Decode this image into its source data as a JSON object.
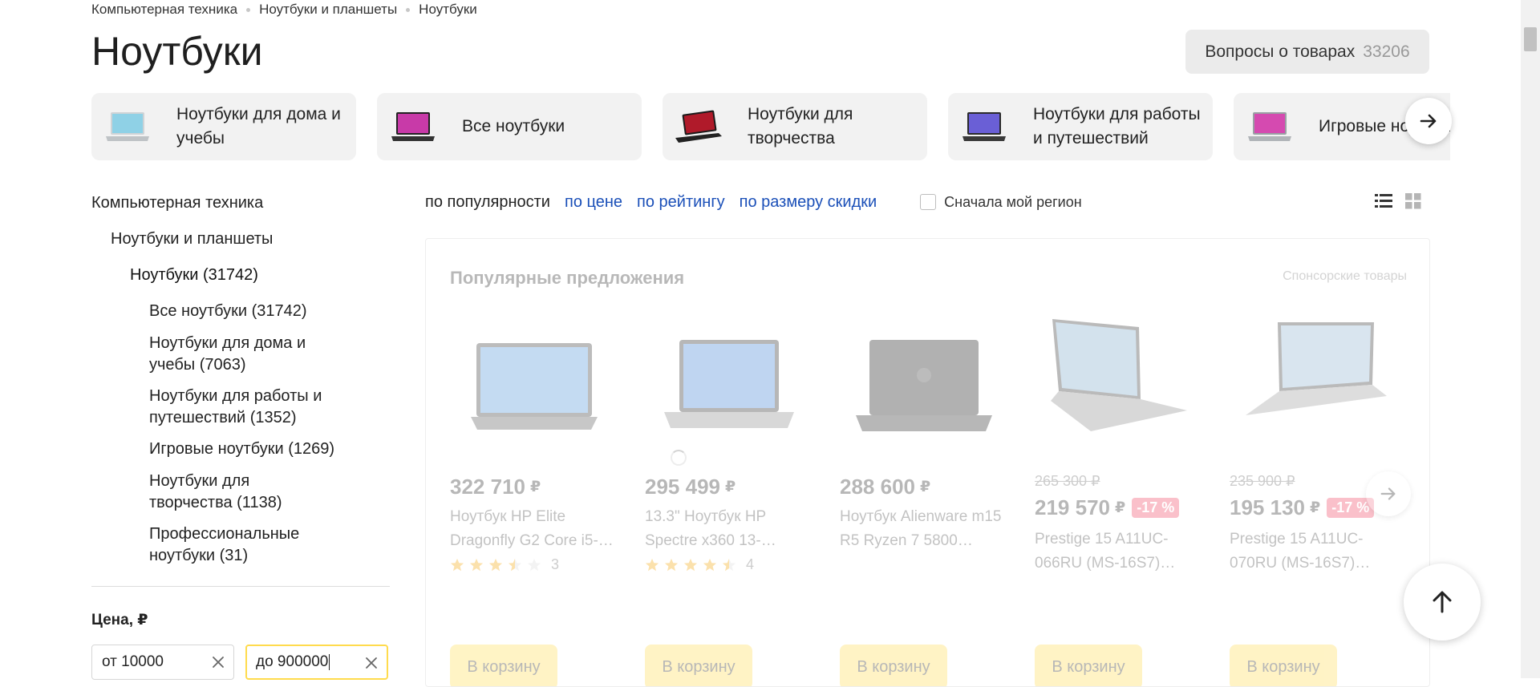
{
  "breadcrumbs": [
    "Компьютерная техника",
    "Ноутбуки и планшеты",
    "Ноутбуки"
  ],
  "page": {
    "title": "Ноутбуки",
    "questions_label": "Вопросы о товарах",
    "questions_count": "33206"
  },
  "tiles": [
    {
      "label": "Ноутбуки для дома и учебы",
      "screen": "#8fd1e6"
    },
    {
      "label": "Все ноутбуки",
      "screen": "#c83aa8"
    },
    {
      "label": "Ноутбуки для творчества",
      "screen": "#b01a2a"
    },
    {
      "label": "Ноутбуки для работы и путешествий",
      "screen": "#6a5fd6"
    },
    {
      "label": "Игровые ноутбуки",
      "screen": "#d54ab0"
    }
  ],
  "sidebar": {
    "categories": [
      {
        "label": "Компьютерная техника",
        "level": 0
      },
      {
        "label": "Ноутбуки и планшеты",
        "level": 1
      },
      {
        "label": "Ноутбуки (31742)",
        "level": 2,
        "current": true
      },
      {
        "label": "Все ноутбуки (31742)",
        "level": 3
      },
      {
        "label": "Ноутбуки для дома и",
        "label2": "учебы (7063)",
        "level": 3
      },
      {
        "label": "Ноутбуки для работы и",
        "label2": "путешествий (1352)",
        "level": 3
      },
      {
        "label": "Игровые ноутбуки (1269)",
        "level": 3
      },
      {
        "label": "Ноутбуки для",
        "label2": "творчества (1138)",
        "level": 3
      },
      {
        "label": "Профессиональные",
        "label2": "ноутбуки (31)",
        "level": 3
      }
    ],
    "price_title": "Цена, ₽",
    "price_from": "от 10000",
    "price_to": "до 900000"
  },
  "sort": {
    "items": [
      "по популярности",
      "по цене",
      "по рейтингу",
      "по размеру скидки"
    ],
    "active_index": 0,
    "region_label": "Сначала мой регион"
  },
  "offers": {
    "title": "Популярные предложения",
    "sponsored": "Спонсорские товары",
    "cart_label": "В корзину",
    "currency": "₽",
    "items": [
      {
        "price": "322 710",
        "name": "Ноутбук HP Elite Dragonfly G2 Core i5-…",
        "rating": 3.5,
        "reviews": "3",
        "screen": "#4a90d9"
      },
      {
        "price": "295 499",
        "name": "13.3\" Ноутбук HP Spectre x360 13-…",
        "rating": 4.5,
        "reviews": "4",
        "screen": "#3b7fd4"
      },
      {
        "price": "288 600",
        "name": "Ноутбук Alienware m15 R5 Ryzen 7 5800…",
        "screen": "#111111"
      },
      {
        "old_price": "265 300 ₽",
        "price": "219 570",
        "discount": "-17 %",
        "name": "Prestige 15 A11UC-066RU (MS-16S7)…",
        "screen": "#7aa6c8"
      },
      {
        "old_price": "235 900 ₽",
        "price": "195 130",
        "discount": "-17 %",
        "name": "Prestige 15 A11UC-070RU (MS-16S7)…",
        "screen": "#8ab0cf"
      }
    ]
  },
  "colors": {
    "accent_yellow": "#ffdb4d",
    "link_blue": "#1a4fb8",
    "discount_red": "#f23d5c"
  }
}
